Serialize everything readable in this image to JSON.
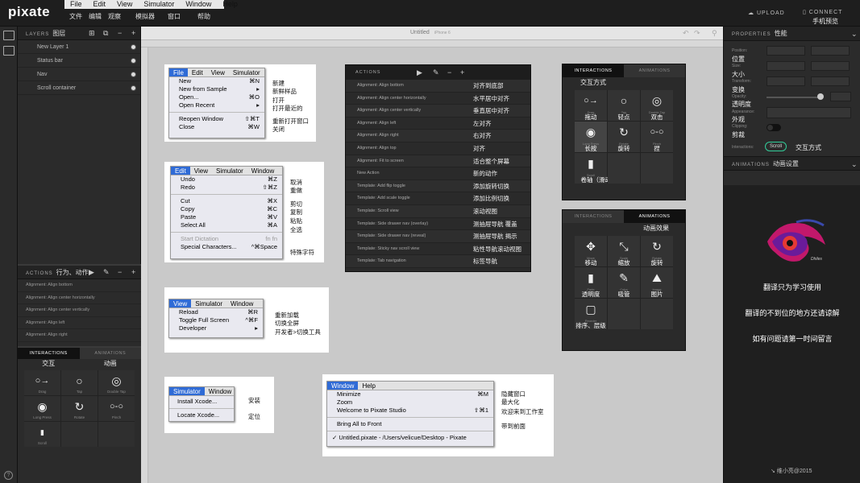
{
  "topbar": {
    "logo": "pixate",
    "menu": [
      "File",
      "Edit",
      "View",
      "Simulator",
      "Window",
      "Help"
    ],
    "menu_cn": [
      "文件",
      "编辑",
      "观察",
      "模拟器",
      "窗口",
      "帮助"
    ],
    "upload": "UPLOAD",
    "connect": "CONNECT",
    "connect_cn": "手机预览"
  },
  "layers": {
    "head": "LAYERS",
    "head_cn": "图层",
    "items": [
      "New Layer 1",
      "Status bar",
      "Nav",
      "Scroll container"
    ]
  },
  "left_actions": {
    "head": "ACTIONS",
    "head_cn": "行为、动作",
    "items": [
      "Alignment: Align bottom",
      "Alignment: Align center horizontally",
      "Alignment: Align center vertically",
      "Alignment: Align left",
      "Alignment: Align right"
    ]
  },
  "left_inter": {
    "tab1": "INTERACTIONS",
    "tab2": "ANIMATIONS",
    "cn1": "交互",
    "cn2": "动画",
    "cells": [
      "Drag",
      "Tap",
      "Double Tap",
      "Long Press",
      "Rotate",
      "Pinch",
      "Scroll"
    ]
  },
  "canvas": {
    "title": "Untitled",
    "device": "iPhone 6"
  },
  "file_menu": {
    "bar": [
      "File",
      "Edit",
      "View",
      "Simulator"
    ],
    "items": [
      {
        "l": "New",
        "s": "⌘N"
      },
      {
        "l": "New from Sample",
        "s": "▸"
      },
      {
        "l": "Open...",
        "s": "⌘O"
      },
      {
        "l": "Open Recent",
        "s": "▸"
      },
      {
        "l": "Reopen Window",
        "s": "⇧⌘T"
      },
      {
        "l": "Close",
        "s": "⌘W"
      }
    ],
    "notes": [
      "新建",
      "新鲜样品",
      "打开",
      "打开最近的",
      "重新打开窗口",
      "关闭"
    ]
  },
  "edit_menu": {
    "bar": [
      "Edit",
      "View",
      "Simulator",
      "Window"
    ],
    "items": [
      {
        "l": "Undo",
        "s": "⌘Z"
      },
      {
        "l": "Redo",
        "s": "⇧⌘Z"
      },
      {
        "l": "Cut",
        "s": "⌘X"
      },
      {
        "l": "Copy",
        "s": "⌘C"
      },
      {
        "l": "Paste",
        "s": "⌘V"
      },
      {
        "l": "Select All",
        "s": "⌘A"
      },
      {
        "l": "Start Dictation",
        "s": "fn fn"
      },
      {
        "l": "Special Characters...",
        "s": "^⌘Space"
      }
    ],
    "notes": [
      "取消",
      "重做",
      "剪切",
      "复制",
      "粘贴",
      "全选",
      "特殊字符"
    ]
  },
  "view_menu": {
    "bar": [
      "View",
      "Simulator",
      "Window"
    ],
    "items": [
      {
        "l": "Reload",
        "s": "⌘R"
      },
      {
        "l": "Toggle Full Screen",
        "s": "^⌘F"
      },
      {
        "l": "Developer",
        "s": "▸"
      }
    ],
    "notes": [
      "重新加载",
      "切换全屏",
      "开发者>切换工具"
    ]
  },
  "sim_menu": {
    "bar": [
      "Simulator",
      "Window"
    ],
    "items": [
      {
        "l": "Install Xcode...",
        "s": ""
      },
      {
        "l": "Locate Xcode...",
        "s": ""
      }
    ],
    "notes": [
      "安装",
      "定位"
    ]
  },
  "window_menu": {
    "bar": [
      "Window",
      "Help"
    ],
    "items": [
      {
        "l": "Minimize",
        "s": "⌘M"
      },
      {
        "l": "Zoom",
        "s": ""
      },
      {
        "l": "Welcome to Pixate Studio",
        "s": "⇧⌘1"
      },
      {
        "l": "Bring All to Front",
        "s": ""
      },
      {
        "l": "✓ Untitled.pixate - /Users/velicue/Desktop - Pixate",
        "s": ""
      }
    ],
    "notes": [
      "隐藏窗口",
      "最大化",
      "欢迎来到工作室",
      "带到前面"
    ]
  },
  "actlist": {
    "head": "ACTIONS",
    "rows": [
      {
        "en": "Alignment: Align bottom",
        "cn": "对齐到底部"
      },
      {
        "en": "Alignment: Align center horizontally",
        "cn": "水平居中对齐"
      },
      {
        "en": "Alignment: Align center vertically",
        "cn": "垂直居中对齐"
      },
      {
        "en": "Alignment: Align left",
        "cn": "左对齐"
      },
      {
        "en": "Alignment: Align right",
        "cn": "右对齐"
      },
      {
        "en": "Alignment: Align top",
        "cn": "对齐"
      },
      {
        "en": "Alignment: Fit to screen",
        "cn": "适合整个屏幕"
      },
      {
        "en": "New Action",
        "cn": "新的动作"
      },
      {
        "en": "Template: Add flip toggle",
        "cn": "添加旋转切换"
      },
      {
        "en": "Template: Add scale toggle",
        "cn": "添加比例切换"
      },
      {
        "en": "Template: Scroll view",
        "cn": "滚动视图"
      },
      {
        "en": "Template: Side drawer nav (overlay)",
        "cn": "测抽屉导航  覆盖"
      },
      {
        "en": "Template: Side drawer nav (reveal)",
        "cn": "测抽屉导航  揭示"
      },
      {
        "en": "Template: Sticky nav scroll view",
        "cn": "粘性导航滚动视图"
      },
      {
        "en": "Template: Tab navigation",
        "cn": "标签导航"
      }
    ]
  },
  "inter_big": {
    "tab1": "INTERACTIONS",
    "tab2": "ANIMATIONS",
    "title_cn": "交互方式",
    "cells": [
      {
        "en": "Drag",
        "cn": "拖动"
      },
      {
        "en": "Tap",
        "cn": "轻点"
      },
      {
        "en": "Double Tap",
        "cn": "双击"
      },
      {
        "en": "Long Press",
        "cn": "长按"
      },
      {
        "en": "Rotate",
        "cn": "旋转"
      },
      {
        "en": "Pinch",
        "cn": "捏"
      },
      {
        "en": "Scroll",
        "cn": "卷轴（滑动）"
      }
    ]
  },
  "anim_big": {
    "tab1": "INTERACTIONS",
    "tab2": "ANIMATIONS",
    "title_cn": "动画效果",
    "cells": [
      {
        "en": "Move",
        "cn": "移动"
      },
      {
        "en": "Scale",
        "cn": "缩放"
      },
      {
        "en": "Rotate",
        "cn": "旋转"
      },
      {
        "en": "Fade",
        "cn": "透明度"
      },
      {
        "en": "Color",
        "cn": "吸管"
      },
      {
        "en": "Image",
        "cn": "图片"
      },
      {
        "en": "Reorder",
        "cn": "排序、层级"
      }
    ]
  },
  "props": {
    "head": "PROPERTIES",
    "head_cn": "性能",
    "rows": [
      {
        "en": "Position:",
        "cn": "位置"
      },
      {
        "en": "Size:",
        "cn": "大小"
      },
      {
        "en": "Transform:",
        "cn": "变换"
      },
      {
        "en": "Opacity:",
        "cn": "透明度"
      },
      {
        "en": "Appearance:",
        "cn": "外观"
      },
      {
        "en": "Clipping:",
        "cn": "剪裁"
      }
    ],
    "interactions_label": "Interactions:",
    "scroll_badge": "Scroll",
    "interactions_cn": "交互方式",
    "anim_head": "ANIMATIONS",
    "anim_head_cn": "动画设置",
    "logo_text": "Dhiles",
    "notes": [
      "翻译只为学习使用",
      "翻译的不到位的地方还请谅解",
      "如有问题请第一时间留言"
    ],
    "credit": "↘ 维小亮@2015"
  }
}
